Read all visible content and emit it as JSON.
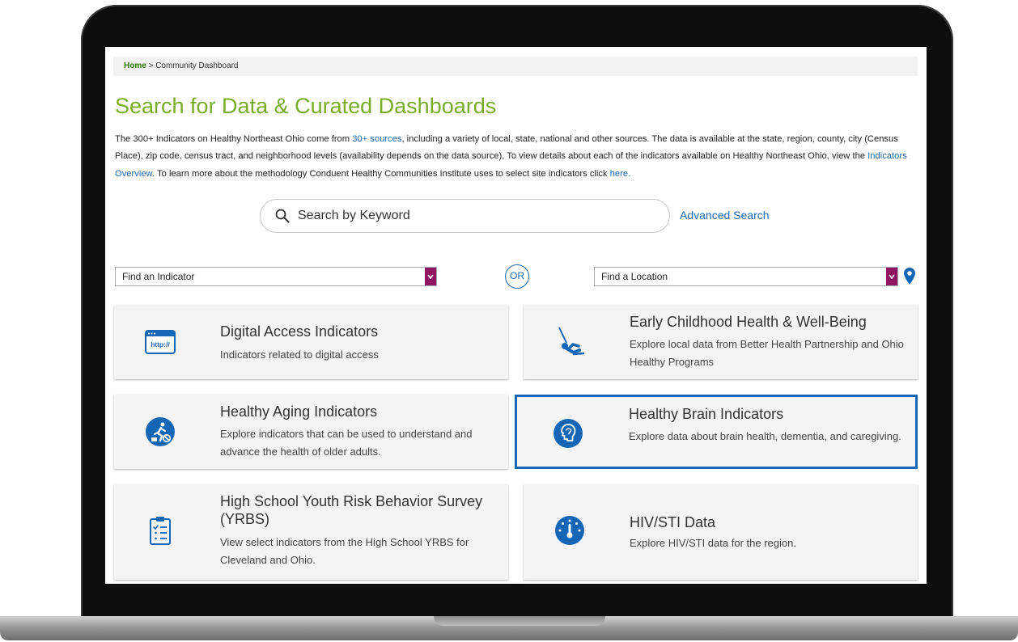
{
  "breadcrumb": {
    "home": "Home",
    "separator": ">",
    "current": "Community Dashboard"
  },
  "page_title": "Search for Data & Curated Dashboards",
  "intro": {
    "part1": "The 300+ Indicators on Healthy Northeast Ohio come from ",
    "sources_link": "30+ sources",
    "part2": ", including a variety of local, state, national and other sources. The data is available at the state, region, county, city (Census Place), zip code, census tract, and neighborhood levels (availability depends on the data source). To view details about each of the indicators available on Healthy Northeast Ohio, view the ",
    "overview_link": "Indicators Overview.",
    "part3": " To learn more about the methodology Conduent Healthy Communities Institute uses to select site indicators click ",
    "here_link": "here."
  },
  "search": {
    "placeholder": "Search by Keyword",
    "advanced_label": "Advanced Search"
  },
  "find_indicator": {
    "value": "Find an Indicator"
  },
  "or_label": "OR",
  "find_location": {
    "value": "Find a Location"
  },
  "colors": {
    "accent_green": "#79ac27",
    "link_blue": "#1d68b5",
    "icon_blue": "#1566b5",
    "dropdown_purple": "#8f1761"
  },
  "cards": [
    {
      "title": "Digital Access Indicators",
      "description": "Indicators related to digital access",
      "icon": "browser-icon",
      "icon_text": "http://"
    },
    {
      "title": "Early Childhood Health & Well-Being",
      "description": "Explore local data from Better Health Partnership and Ohio Healthy Programs",
      "icon": "swing-icon"
    },
    {
      "title": "Healthy Aging Indicators",
      "description": "Explore indicators that can be used to understand and advance the health of older adults.",
      "icon": "active-aging-icon"
    },
    {
      "title": "Healthy Brain Indicators",
      "description": "Explore data about brain health, dementia, and caregiving.",
      "icon": "brain-icon",
      "selected": true
    },
    {
      "title": "High School Youth Risk Behavior Survey (YRBS)",
      "description": "View select indicators from the High School YRBS for Cleveland and Ohio.",
      "icon": "clipboard-icon"
    },
    {
      "title": "HIV/STI Data",
      "description": "Explore HIV/STI data for the region.",
      "icon": "gauge-icon"
    }
  ]
}
